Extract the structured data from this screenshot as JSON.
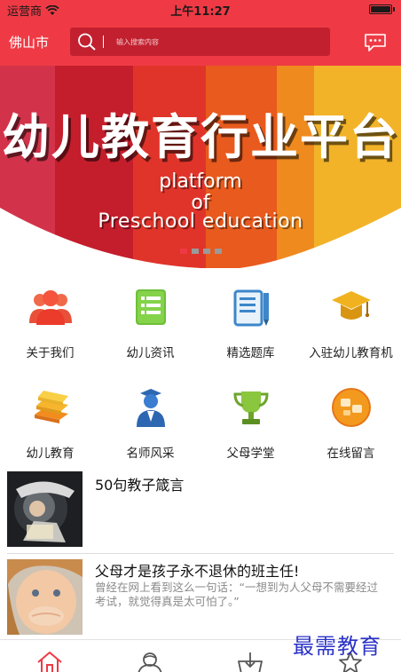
{
  "status_bar": {
    "carrier": "运营商",
    "time": "上午11:27",
    "battery_level": 1.0
  },
  "header": {
    "city": "佛山市",
    "search_placeholder": "输入搜索内容",
    "icons": [
      "search-icon",
      "message-icon"
    ]
  },
  "banner": {
    "headline": "幼儿教育行业平台",
    "sub_line_1": "platform",
    "sub_line_2": "of",
    "sub_line_3": "Preschool education",
    "stripe_colors": [
      "#d2334a",
      "#c41e2c",
      "#e0342a",
      "#e85a1d",
      "#ef8a1f",
      "#f2b329"
    ],
    "page_count": 4,
    "active_page": 1
  },
  "menu": {
    "items": [
      {
        "label": "关于我们",
        "icon": "people-icon"
      },
      {
        "label": "幼儿资讯",
        "icon": "news-list-icon"
      },
      {
        "label": "精选题库",
        "icon": "question-bank-icon"
      },
      {
        "label": "入驻幼儿教育机",
        "icon": "graduation-cap-icon"
      },
      {
        "label": "幼儿教育",
        "icon": "books-icon"
      },
      {
        "label": "名师风采",
        "icon": "teacher-icon"
      },
      {
        "label": "父母学堂",
        "icon": "trophy-icon"
      },
      {
        "label": "在线留言",
        "icon": "online-message-icon"
      }
    ]
  },
  "articles": [
    {
      "title": "50句教子箴言",
      "description": ""
    },
    {
      "title": "父母才是孩子永不退休的班主任!",
      "description": "曾经在网上看到这么一句话：“一想到为人父母不需要经过考试，就觉得真是太可怕了。”"
    }
  ],
  "tabbar": {
    "tabs": [
      {
        "icon": "home-icon",
        "active": true
      },
      {
        "icon": "user-icon",
        "active": false
      },
      {
        "icon": "cart-icon",
        "active": false
      },
      {
        "icon": "star-icon",
        "active": false
      }
    ]
  },
  "watermark": "最需教育",
  "colors": {
    "accent": "#ef3a45",
    "search_bg": "#c2202f"
  }
}
